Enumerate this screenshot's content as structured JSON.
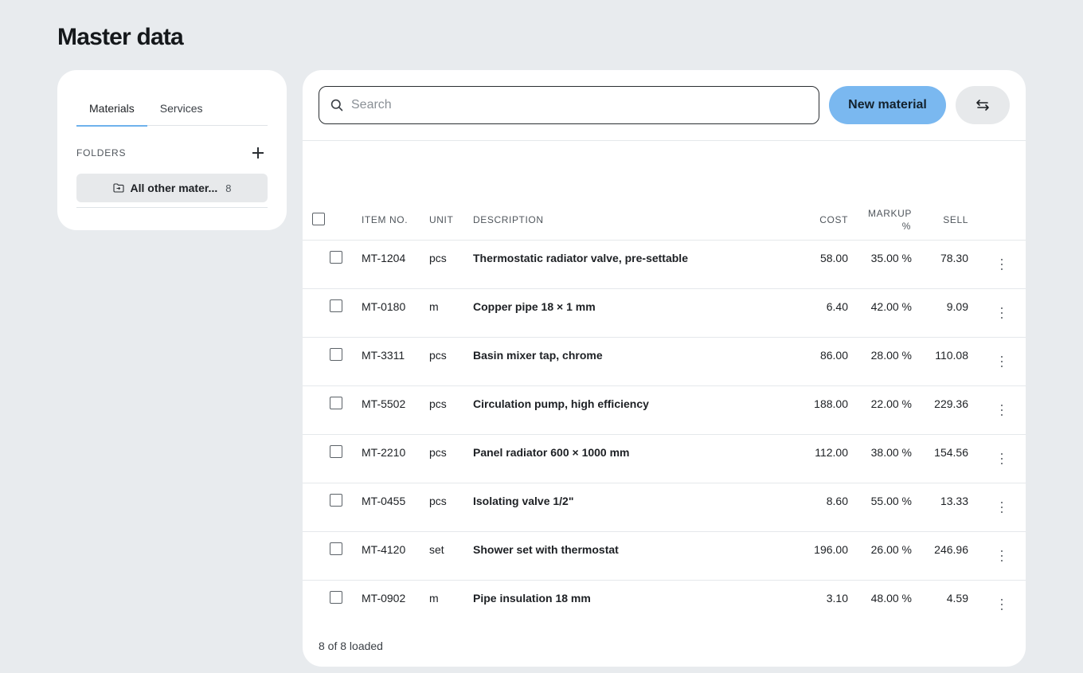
{
  "page": {
    "title": "Master data"
  },
  "sidebar": {
    "tabs": [
      {
        "label": "Materials",
        "active": true
      },
      {
        "label": "Services",
        "active": false
      }
    ],
    "folders_label": "FOLDERS",
    "folder": {
      "name": "All other mater...",
      "count": "8"
    }
  },
  "toolbar": {
    "search_placeholder": "Search",
    "new_button": "New material"
  },
  "table": {
    "headers": {
      "item_no": "ITEM NO.",
      "unit": "UNIT",
      "description": "DESCRIPTION",
      "cost": "COST",
      "markup": "MARKUP",
      "markup_unit": "%",
      "sell": "SELL"
    },
    "rows": [
      {
        "item": "MT-1204",
        "unit": "pcs",
        "desc": "Thermostatic radiator valve, pre-settable",
        "cost": "58.00",
        "markup": "35.00 %",
        "sell": "78.30"
      },
      {
        "item": "MT-0180",
        "unit": "m",
        "desc": "Copper pipe 18 × 1 mm",
        "cost": "6.40",
        "markup": "42.00 %",
        "sell": "9.09"
      },
      {
        "item": "MT-3311",
        "unit": "pcs",
        "desc": "Basin mixer tap, chrome",
        "cost": "86.00",
        "markup": "28.00 %",
        "sell": "110.08"
      },
      {
        "item": "MT-5502",
        "unit": "pcs",
        "desc": "Circulation pump, high efficiency",
        "cost": "188.00",
        "markup": "22.00 %",
        "sell": "229.36"
      },
      {
        "item": "MT-2210",
        "unit": "pcs",
        "desc": "Panel radiator 600 × 1000 mm",
        "cost": "112.00",
        "markup": "38.00 %",
        "sell": "154.56"
      },
      {
        "item": "MT-0455",
        "unit": "pcs",
        "desc": "Isolating valve 1/2\"",
        "cost": "8.60",
        "markup": "55.00 %",
        "sell": "13.33"
      },
      {
        "item": "MT-4120",
        "unit": "set",
        "desc": "Shower set with thermostat",
        "cost": "196.00",
        "markup": "26.00 %",
        "sell": "246.96"
      },
      {
        "item": "MT-0902",
        "unit": "m",
        "desc": "Pipe insulation 18 mm",
        "cost": "3.10",
        "markup": "48.00 %",
        "sell": "4.59"
      }
    ]
  },
  "footer": {
    "status": "8 of 8 loaded"
  },
  "colors": {
    "accent": "#7ab8f0",
    "background": "#e8ebee",
    "tab_underline": "#6fb2ec"
  }
}
